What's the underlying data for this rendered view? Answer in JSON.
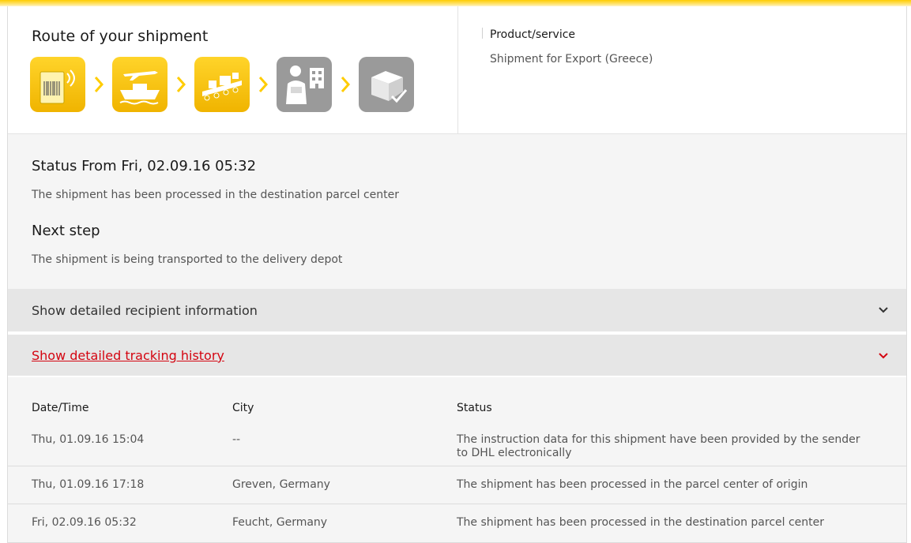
{
  "route": {
    "title": "Route of your shipment",
    "steps": [
      {
        "icon": "parcel-label-icon",
        "state": "done"
      },
      {
        "icon": "plane-ship-icon",
        "state": "done"
      },
      {
        "icon": "conveyor-icon",
        "state": "done"
      },
      {
        "icon": "courier-delivery-icon",
        "state": "pending"
      },
      {
        "icon": "box-delivered-icon",
        "state": "pending"
      }
    ],
    "colors": {
      "done": "#FFCC00",
      "pending": "#9A9A9A",
      "chevron": "#FFCC00"
    }
  },
  "product": {
    "label": "Product/service",
    "value": "Shipment for Export (Greece)"
  },
  "status": {
    "title": "Status From Fri, 02.09.16 05:32",
    "text": "The shipment has been processed in the destination parcel center",
    "next_title": "Next step",
    "next_text": "The shipment is being transported to the delivery depot"
  },
  "accordions": {
    "recipient": {
      "label": "Show detailed recipient information",
      "icon": "chevron-down-icon"
    },
    "history": {
      "label": "Show detailed tracking history",
      "icon": "chevron-down-icon",
      "accent": "#D40511"
    }
  },
  "history": {
    "headers": [
      "Date/Time",
      "City",
      "Status"
    ],
    "rows": [
      {
        "datetime": "Thu, 01.09.16 15:04",
        "city": "--",
        "status": "The instruction data for this shipment have been provided by the sender to DHL electronically"
      },
      {
        "datetime": "Thu, 01.09.16 17:18",
        "city": "Greven, Germany",
        "status": "The shipment has been processed in the parcel center of origin"
      },
      {
        "datetime": "Fri, 02.09.16 05:32",
        "city": "Feucht, Germany",
        "status": "The shipment has been processed in the destination parcel center"
      }
    ]
  }
}
